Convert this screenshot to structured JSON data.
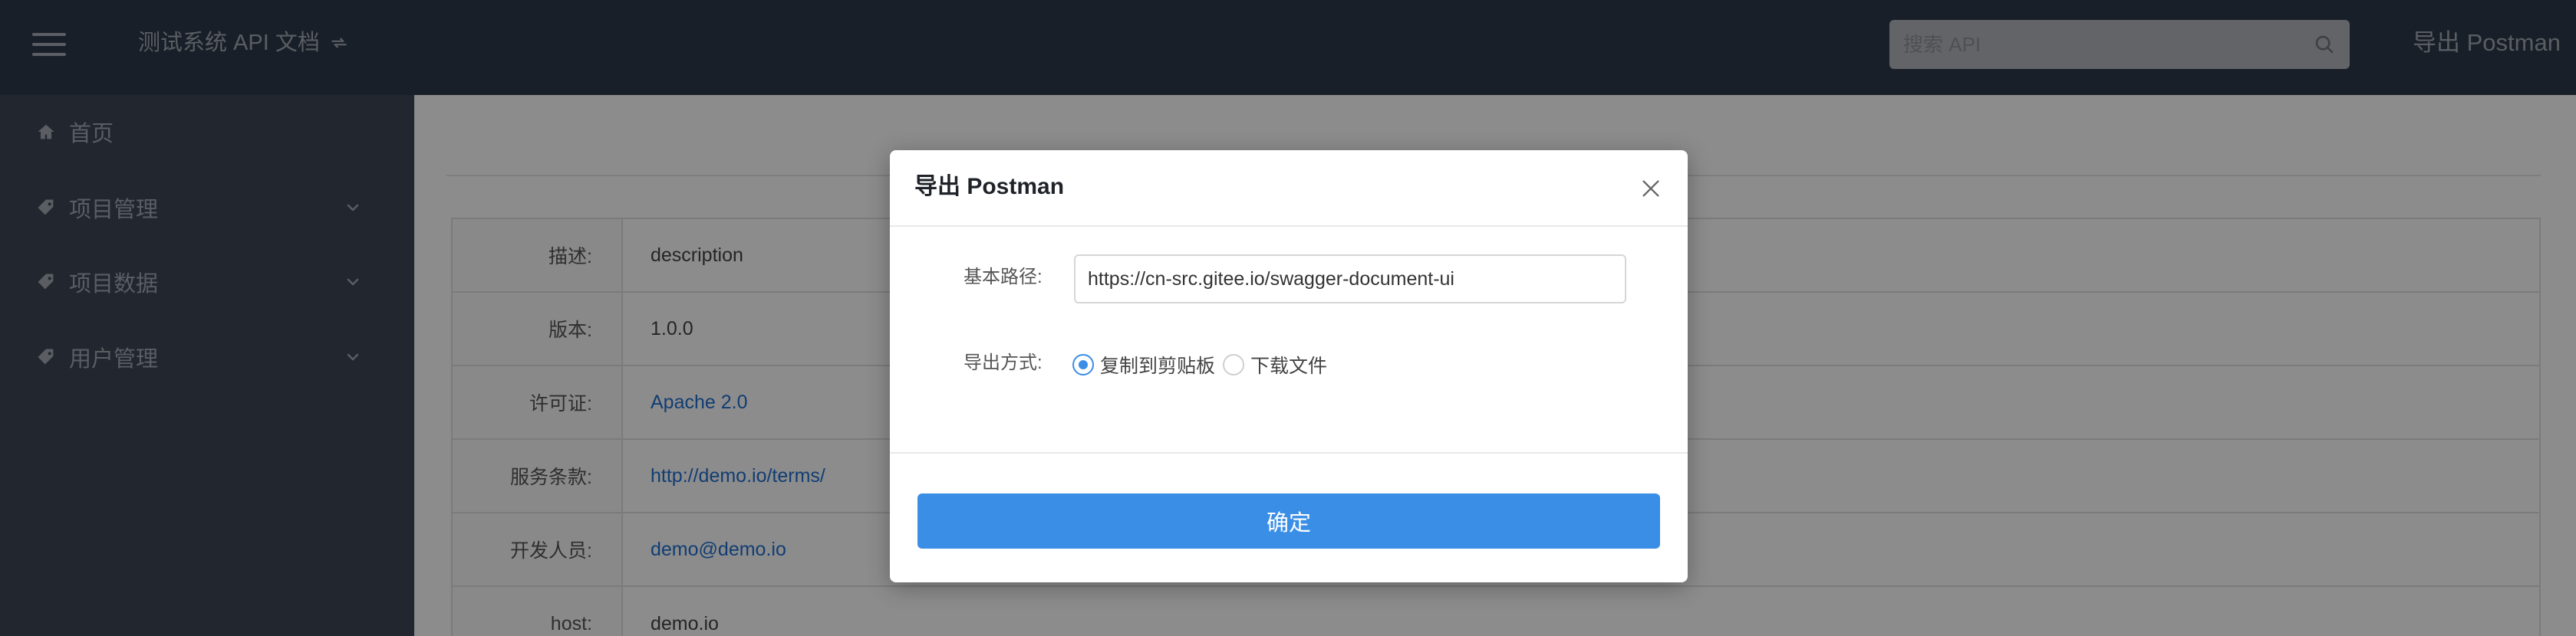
{
  "header": {
    "title": "测试系统 API 文档",
    "search_placeholder": "搜索 API",
    "export_label": "导出 Postman"
  },
  "sidebar": {
    "items": [
      {
        "label": "首页",
        "icon": "home-icon"
      },
      {
        "label": "项目管理",
        "icon": "tag-icon"
      },
      {
        "label": "项目数据",
        "icon": "tag-icon"
      },
      {
        "label": "用户管理",
        "icon": "tag-icon"
      }
    ]
  },
  "info": {
    "rows": [
      {
        "key": "描述:",
        "value": "description"
      },
      {
        "key": "版本:",
        "value": "1.0.0"
      },
      {
        "key": "许可证:",
        "value": "Apache 2.0"
      },
      {
        "key": "服务条款:",
        "value": "http://demo.io/terms/"
      },
      {
        "key": "开发人员:",
        "value": "demo@demo.io"
      },
      {
        "key": "host:",
        "value": "demo.io"
      }
    ]
  },
  "modal": {
    "title": "导出 Postman",
    "base_path_label": "基本路径:",
    "base_path_value": "https://cn-src.gitee.io/swagger-document-ui",
    "export_mode_label": "导出方式:",
    "options": [
      {
        "label": "复制到剪贴板",
        "checked": true
      },
      {
        "label": "下载文件",
        "checked": false
      }
    ],
    "confirm_label": "确定"
  },
  "colors": {
    "header_bg": "#2f3a4b",
    "sidebar_bg": "#3e4756",
    "accent": "#3a8ee6",
    "link": "#1f6fd1"
  }
}
